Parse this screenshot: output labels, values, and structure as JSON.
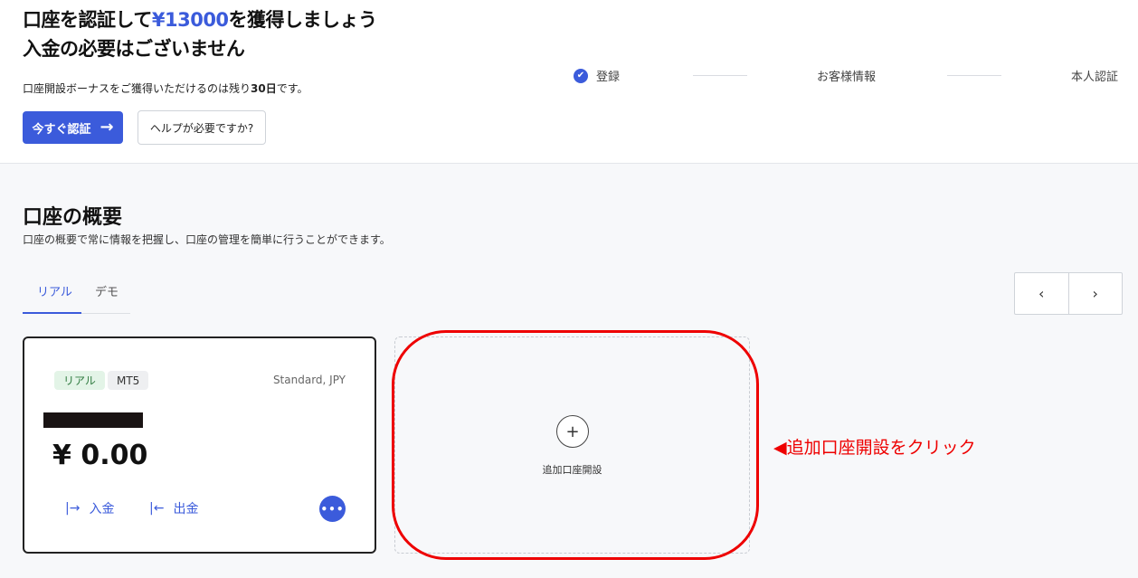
{
  "promo": {
    "headline_pre": "口座を認証して",
    "headline_amount": "¥13000",
    "headline_post": "を獲得しましょう",
    "headline_line2": "入金の必要はございません",
    "sub_pre": "口座開設ボーナスをご獲得いただけるのは残り",
    "sub_days": "30日",
    "sub_post": "です。",
    "verify_button": "今すぐ認証",
    "help_button": "ヘルプが必要ですか?"
  },
  "steps": [
    {
      "label": "登録",
      "done": true
    },
    {
      "label": "お客様情報",
      "done": false
    },
    {
      "label": "本人認証",
      "done": false
    }
  ],
  "overview": {
    "title": "口座の概要",
    "subtitle": "口座の概要で常に情報を把握し、口座の管理を簡単に行うことができます。",
    "tabs": [
      {
        "label": "リアル",
        "active": true
      },
      {
        "label": "デモ",
        "active": false
      }
    ],
    "pager": {
      "prev": "‹",
      "next": "›"
    }
  },
  "account_card": {
    "badge_type": "リアル",
    "badge_platform": "MT5",
    "account_type": "Standard, JPY",
    "balance": "¥ 0.00",
    "deposit_icon": "|→",
    "deposit_label": "入金",
    "withdraw_icon": "|←",
    "withdraw_label": "出金",
    "more_icon": "•••"
  },
  "add_account": {
    "icon": "+",
    "label": "追加口座開設"
  },
  "annotation": {
    "text": "◀追加口座開設をクリック",
    "color": "#e00000"
  },
  "colors": {
    "accent": "#3b5bdb",
    "real_badge_bg": "#e3f4e7",
    "annotation_red": "#e00000"
  }
}
